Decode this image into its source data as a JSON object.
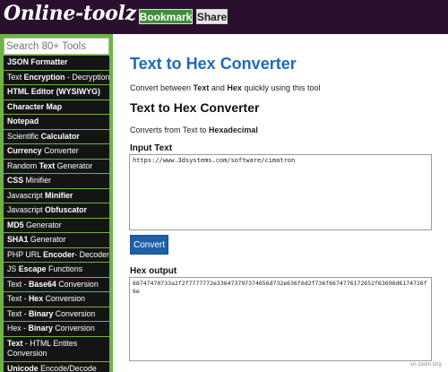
{
  "header": {
    "logo": "Online-toolz",
    "bookmark_label": "Bookmark",
    "share_label": "Share"
  },
  "sidebar": {
    "search_placeholder": "Search 80+ Tools",
    "items": [
      {
        "bold": "JSON Formatter",
        "rest": ""
      },
      {
        "pre": "Text ",
        "bold": "Encryption",
        "rest": " - Decryption"
      },
      {
        "bold": "HTML Editor (WYSIWYG)",
        "rest": ""
      },
      {
        "bold": "Character Map",
        "rest": ""
      },
      {
        "bold": "Notepad",
        "rest": ""
      },
      {
        "pre": "Scientific ",
        "bold": "Calculator",
        "rest": ""
      },
      {
        "bold": "Currency",
        "rest": " Converter"
      },
      {
        "pre": "Random ",
        "bold": "Text",
        "rest": " Generator"
      },
      {
        "bold": "CSS",
        "rest": " Minifier"
      },
      {
        "pre": "Javascript ",
        "bold": "Minifier",
        "rest": ""
      },
      {
        "pre": "Javascript ",
        "bold": "Obfuscator",
        "rest": ""
      },
      {
        "bold": "MD5",
        "rest": " Generator"
      },
      {
        "bold": "SHA1",
        "rest": " Generator"
      },
      {
        "pre": "PHP URL ",
        "bold": "Encoder",
        "rest": "- Decoder"
      },
      {
        "pre": "JS ",
        "bold": "Escape",
        "rest": " Functions"
      },
      {
        "pre": "Text - ",
        "bold": "Base64",
        "rest": " Conversion"
      },
      {
        "pre": "Text - ",
        "bold": "Hex",
        "rest": " Conversion"
      },
      {
        "pre": "Text - ",
        "bold": "Binary",
        "rest": " Conversion"
      },
      {
        "pre": "Hex - ",
        "bold": "Binary",
        "rest": " Conversion"
      },
      {
        "bold": "Text",
        "rest": " - HTML Entites Conversion"
      },
      {
        "bold": "Unicode",
        "rest": " Encode/Decode"
      }
    ]
  },
  "main": {
    "title": "Text to Hex Converter",
    "intro_pre": "Convert between ",
    "intro_b1": "Text",
    "intro_mid": " and ",
    "intro_b2": "Hex",
    "intro_post": " quickly using this tool",
    "subtitle": "Text to Hex Converter",
    "sub_pre": "Converts from Text to ",
    "sub_b": "Hexadecimal",
    "input_label": "Input Text",
    "input_value": "https://www.3dsystems.com/software/cimatron",
    "convert_label": "Convert",
    "output_label": "Hex output",
    "output_value": "68747470733a2f2f7777772e336473797374656d732e636f6d2f736f6674776172652f63696d6174726f6e"
  },
  "watermark": "vn-zoom.Org"
}
